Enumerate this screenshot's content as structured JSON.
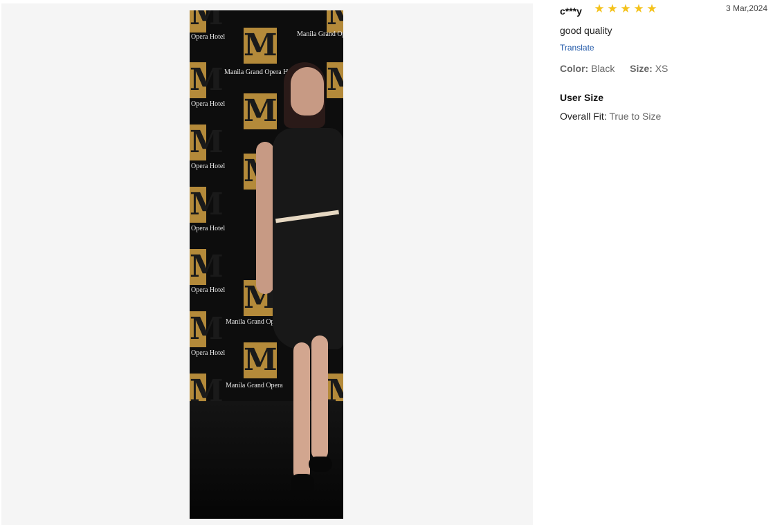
{
  "photo": {
    "backdrop_logo_letter": "M",
    "backdrop_text_1": "Manila Grand Opera Hotel",
    "backdrop_text_2": "Opera Hotel",
    "backdrop_text_3": "Manila Grand Opera"
  },
  "review": {
    "reviewer": "c***y",
    "rating": 5,
    "rating_max": 5,
    "star_icon": "star-icon",
    "star_color": "#f4c21b",
    "date": "3 Mar,2024",
    "text": "good quality",
    "translate_label": "Translate",
    "attributes": {
      "color_label": "Color:",
      "color_value": "Black",
      "size_label": "Size:",
      "size_value": "XS"
    },
    "user_size": {
      "title": "User Size",
      "fit_label": "Overall Fit:",
      "fit_value": "True to Size"
    }
  }
}
